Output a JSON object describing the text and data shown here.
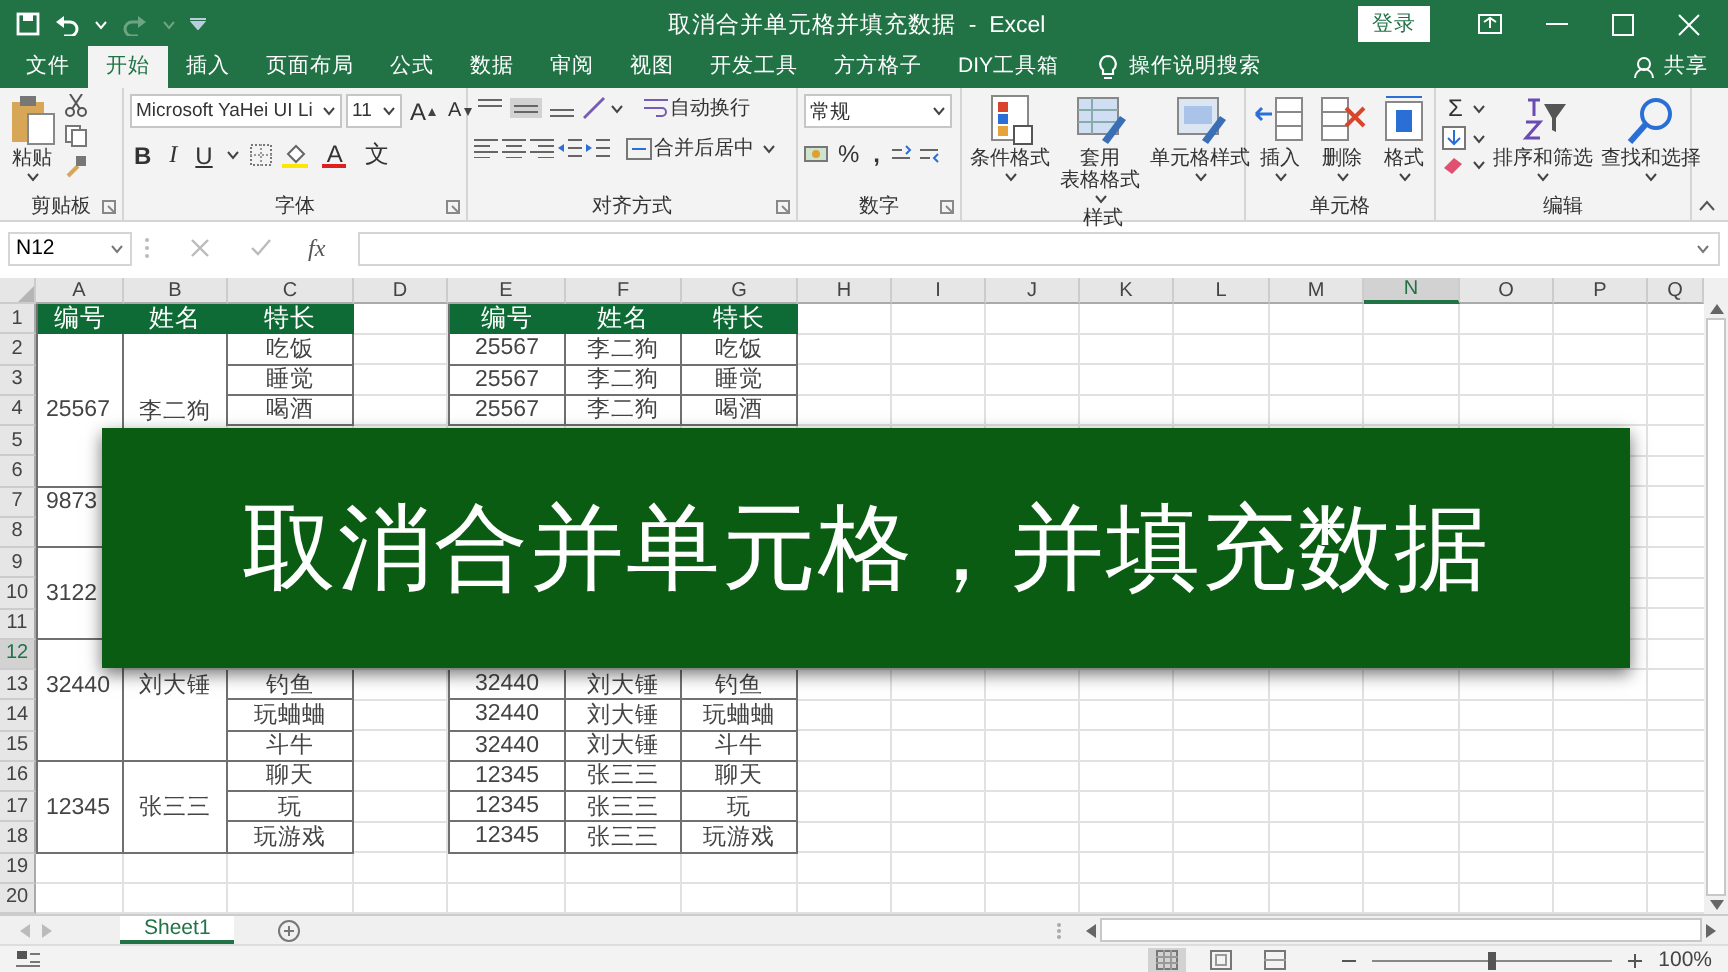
{
  "title_bar": {
    "title": "取消合并单元格并填充数据  -  Excel",
    "login_button": "登录"
  },
  "tabs": [
    {
      "label": "文件",
      "selected": false
    },
    {
      "label": "开始",
      "selected": true
    },
    {
      "label": "插入",
      "selected": false
    },
    {
      "label": "页面布局",
      "selected": false
    },
    {
      "label": "公式",
      "selected": false
    },
    {
      "label": "数据",
      "selected": false
    },
    {
      "label": "审阅",
      "selected": false
    },
    {
      "label": "视图",
      "selected": false
    },
    {
      "label": "开发工具",
      "selected": false
    },
    {
      "label": "方方格子",
      "selected": false
    },
    {
      "label": "DIY工具箱",
      "selected": false
    }
  ],
  "tell_me": "操作说明搜索",
  "share": "共享",
  "ribbon": {
    "clipboard": {
      "label": "剪贴板",
      "paste": "粘贴"
    },
    "font": {
      "label": "字体",
      "font_name": "Microsoft YaHei UI Li",
      "font_size": "11",
      "grow": "A",
      "shrink": "A",
      "bold": "B",
      "italic": "I",
      "underline": "U",
      "font_color": "A",
      "phonetic": "文"
    },
    "alignment": {
      "label": "对齐方式",
      "vertical_align": [
        {
          "selected": false
        },
        {
          "selected": true
        },
        {
          "selected": false
        }
      ],
      "wrap_text": "自动换行",
      "merge_center": "合并后居中"
    },
    "number": {
      "label": "数字",
      "format": "常规",
      "percent": "%",
      "comma": ","
    },
    "styles": {
      "label": "样式",
      "buttons": [
        [
          "条件格式"
        ],
        [
          "套用",
          "表格格式"
        ],
        [
          "单元格样式"
        ]
      ]
    },
    "cells": {
      "label": "单元格",
      "buttons": [
        [
          "插入"
        ],
        [
          "删除"
        ],
        [
          "格式"
        ]
      ]
    },
    "editing": {
      "label": "编辑",
      "autosum": "Σ",
      "buttons": [
        [
          "排序和筛选"
        ],
        [
          "查找和选择"
        ]
      ]
    }
  },
  "formula_bar": {
    "name_box": "N12",
    "fx": "fx"
  },
  "sheet": {
    "columns": [
      {
        "label": "A",
        "selected": false
      },
      {
        "label": "B",
        "selected": false
      },
      {
        "label": "C",
        "selected": false
      },
      {
        "label": "D",
        "selected": false
      },
      {
        "label": "E",
        "selected": false
      },
      {
        "label": "F",
        "selected": false
      },
      {
        "label": "G",
        "selected": false
      },
      {
        "label": "H",
        "selected": false
      },
      {
        "label": "I",
        "selected": false
      },
      {
        "label": "J",
        "selected": false
      },
      {
        "label": "K",
        "selected": false
      },
      {
        "label": "L",
        "selected": false
      },
      {
        "label": "M",
        "selected": false
      },
      {
        "label": "N",
        "selected": true
      },
      {
        "label": "O",
        "selected": false
      },
      {
        "label": "P",
        "selected": false
      },
      {
        "label": "Q",
        "selected": false
      }
    ],
    "rows": [
      {
        "number": "1",
        "selected": false,
        "cells": {
          "A": {
            "text": "编号",
            "kind": "header"
          },
          "B": {
            "text": "姓名",
            "kind": "header"
          },
          "C": {
            "text": "特长",
            "kind": "header"
          },
          "E": {
            "text": "编号",
            "kind": "header"
          },
          "F": {
            "text": "姓名",
            "kind": "header"
          },
          "G": {
            "text": "特长",
            "kind": "header"
          }
        }
      },
      {
        "number": "2",
        "selected": false,
        "cells": {
          "A": {
            "kind": "top"
          },
          "B": {
            "kind": "top"
          },
          "C": {
            "text": "吃饭",
            "kind": "value"
          },
          "E": {
            "text": "25567",
            "kind": "value"
          },
          "F": {
            "text": "李二狗",
            "kind": "value"
          },
          "G": {
            "text": "吃饭",
            "kind": "value"
          }
        }
      },
      {
        "number": "3",
        "selected": false,
        "cells": {
          "A": {
            "kind": "middle"
          },
          "B": {
            "kind": "middle"
          },
          "C": {
            "text": "睡觉",
            "kind": "value"
          },
          "E": {
            "text": "25567",
            "kind": "value"
          },
          "F": {
            "text": "李二狗",
            "kind": "value"
          },
          "G": {
            "text": "睡觉",
            "kind": "value"
          }
        }
      },
      {
        "number": "4",
        "selected": false,
        "cells": {
          "A": {
            "text": "25567",
            "kind": "middle"
          },
          "B": {
            "text": "李二狗",
            "kind": "middle"
          },
          "C": {
            "text": "喝酒",
            "kind": "value"
          },
          "E": {
            "text": "25567",
            "kind": "value"
          },
          "F": {
            "text": "李二狗",
            "kind": "value"
          },
          "G": {
            "text": "喝酒",
            "kind": "value"
          }
        }
      },
      {
        "number": "5",
        "selected": false,
        "cells": {
          "A": {
            "kind": "middle"
          }
        }
      },
      {
        "number": "6",
        "selected": false,
        "cells": {
          "A": {
            "kind": "bottom"
          }
        }
      },
      {
        "number": "7",
        "selected": false,
        "cells": {
          "A": {
            "text": "9873",
            "kind": "top"
          }
        }
      },
      {
        "number": "8",
        "selected": false,
        "cells": {
          "A": {
            "kind": "bottom"
          }
        }
      },
      {
        "number": "9",
        "selected": false,
        "cells": {
          "A": {
            "kind": "top"
          }
        }
      },
      {
        "number": "10",
        "selected": false,
        "cells": {
          "A": {
            "text": "3122",
            "kind": "middle"
          }
        }
      },
      {
        "number": "11",
        "selected": false,
        "cells": {
          "A": {
            "kind": "bottom"
          }
        }
      },
      {
        "number": "12",
        "selected": true,
        "cells": {
          "A": {
            "kind": "top"
          }
        }
      },
      {
        "number": "13",
        "selected": false,
        "cells": {
          "A": {
            "text": "32440",
            "kind": "middle"
          },
          "B": {
            "text": "刘大锤",
            "kind": "middle"
          },
          "C": {
            "text": "钓鱼",
            "kind": "value"
          },
          "E": {
            "text": "32440",
            "kind": "value"
          },
          "F": {
            "text": "刘大锤",
            "kind": "value"
          },
          "G": {
            "text": "钓鱼",
            "kind": "value"
          }
        }
      },
      {
        "number": "14",
        "selected": false,
        "cells": {
          "A": {
            "kind": "middle"
          },
          "B": {
            "kind": "middle"
          },
          "C": {
            "text": "玩蛐蛐",
            "kind": "value"
          },
          "E": {
            "text": "32440",
            "kind": "value"
          },
          "F": {
            "text": "刘大锤",
            "kind": "value"
          },
          "G": {
            "text": "玩蛐蛐",
            "kind": "value"
          }
        }
      },
      {
        "number": "15",
        "selected": false,
        "cells": {
          "A": {
            "kind": "bottom"
          },
          "B": {
            "kind": "bottom"
          },
          "C": {
            "text": "斗牛",
            "kind": "value"
          },
          "E": {
            "text": "32440",
            "kind": "value"
          },
          "F": {
            "text": "刘大锤",
            "kind": "value"
          },
          "G": {
            "text": "斗牛",
            "kind": "value"
          }
        }
      },
      {
        "number": "16",
        "selected": false,
        "cells": {
          "A": {
            "kind": "top"
          },
          "B": {
            "kind": "top"
          },
          "C": {
            "text": "聊天",
            "kind": "value"
          },
          "E": {
            "text": "12345",
            "kind": "value"
          },
          "F": {
            "text": "张三三",
            "kind": "value"
          },
          "G": {
            "text": "聊天",
            "kind": "value"
          }
        }
      },
      {
        "number": "17",
        "selected": false,
        "cells": {
          "A": {
            "text": "12345",
            "kind": "middle"
          },
          "B": {
            "text": "张三三",
            "kind": "middle"
          },
          "C": {
            "text": "玩",
            "kind": "value"
          },
          "E": {
            "text": "12345",
            "kind": "value"
          },
          "F": {
            "text": "张三三",
            "kind": "value"
          },
          "G": {
            "text": "玩",
            "kind": "value"
          }
        }
      },
      {
        "number": "18",
        "selected": false,
        "cells": {
          "A": {
            "kind": "bottom"
          },
          "B": {
            "kind": "bottom"
          },
          "C": {
            "text": "玩游戏",
            "kind": "value"
          },
          "E": {
            "text": "12345",
            "kind": "value"
          },
          "F": {
            "text": "张三三",
            "kind": "value"
          },
          "G": {
            "text": "玩游戏",
            "kind": "value"
          }
        }
      },
      {
        "number": "19",
        "selected": false
      },
      {
        "number": "20",
        "selected": false
      }
    ]
  },
  "banner": "取消合并单元格，并填充数据",
  "sheet_tabs": [
    {
      "label": "Sheet1",
      "selected": true
    }
  ],
  "status_bar": {
    "views": [
      {
        "selected": true
      },
      {
        "selected": false
      },
      {
        "selected": false
      }
    ],
    "zoom": {
      "level": 0.5,
      "reading": "100%"
    }
  }
}
